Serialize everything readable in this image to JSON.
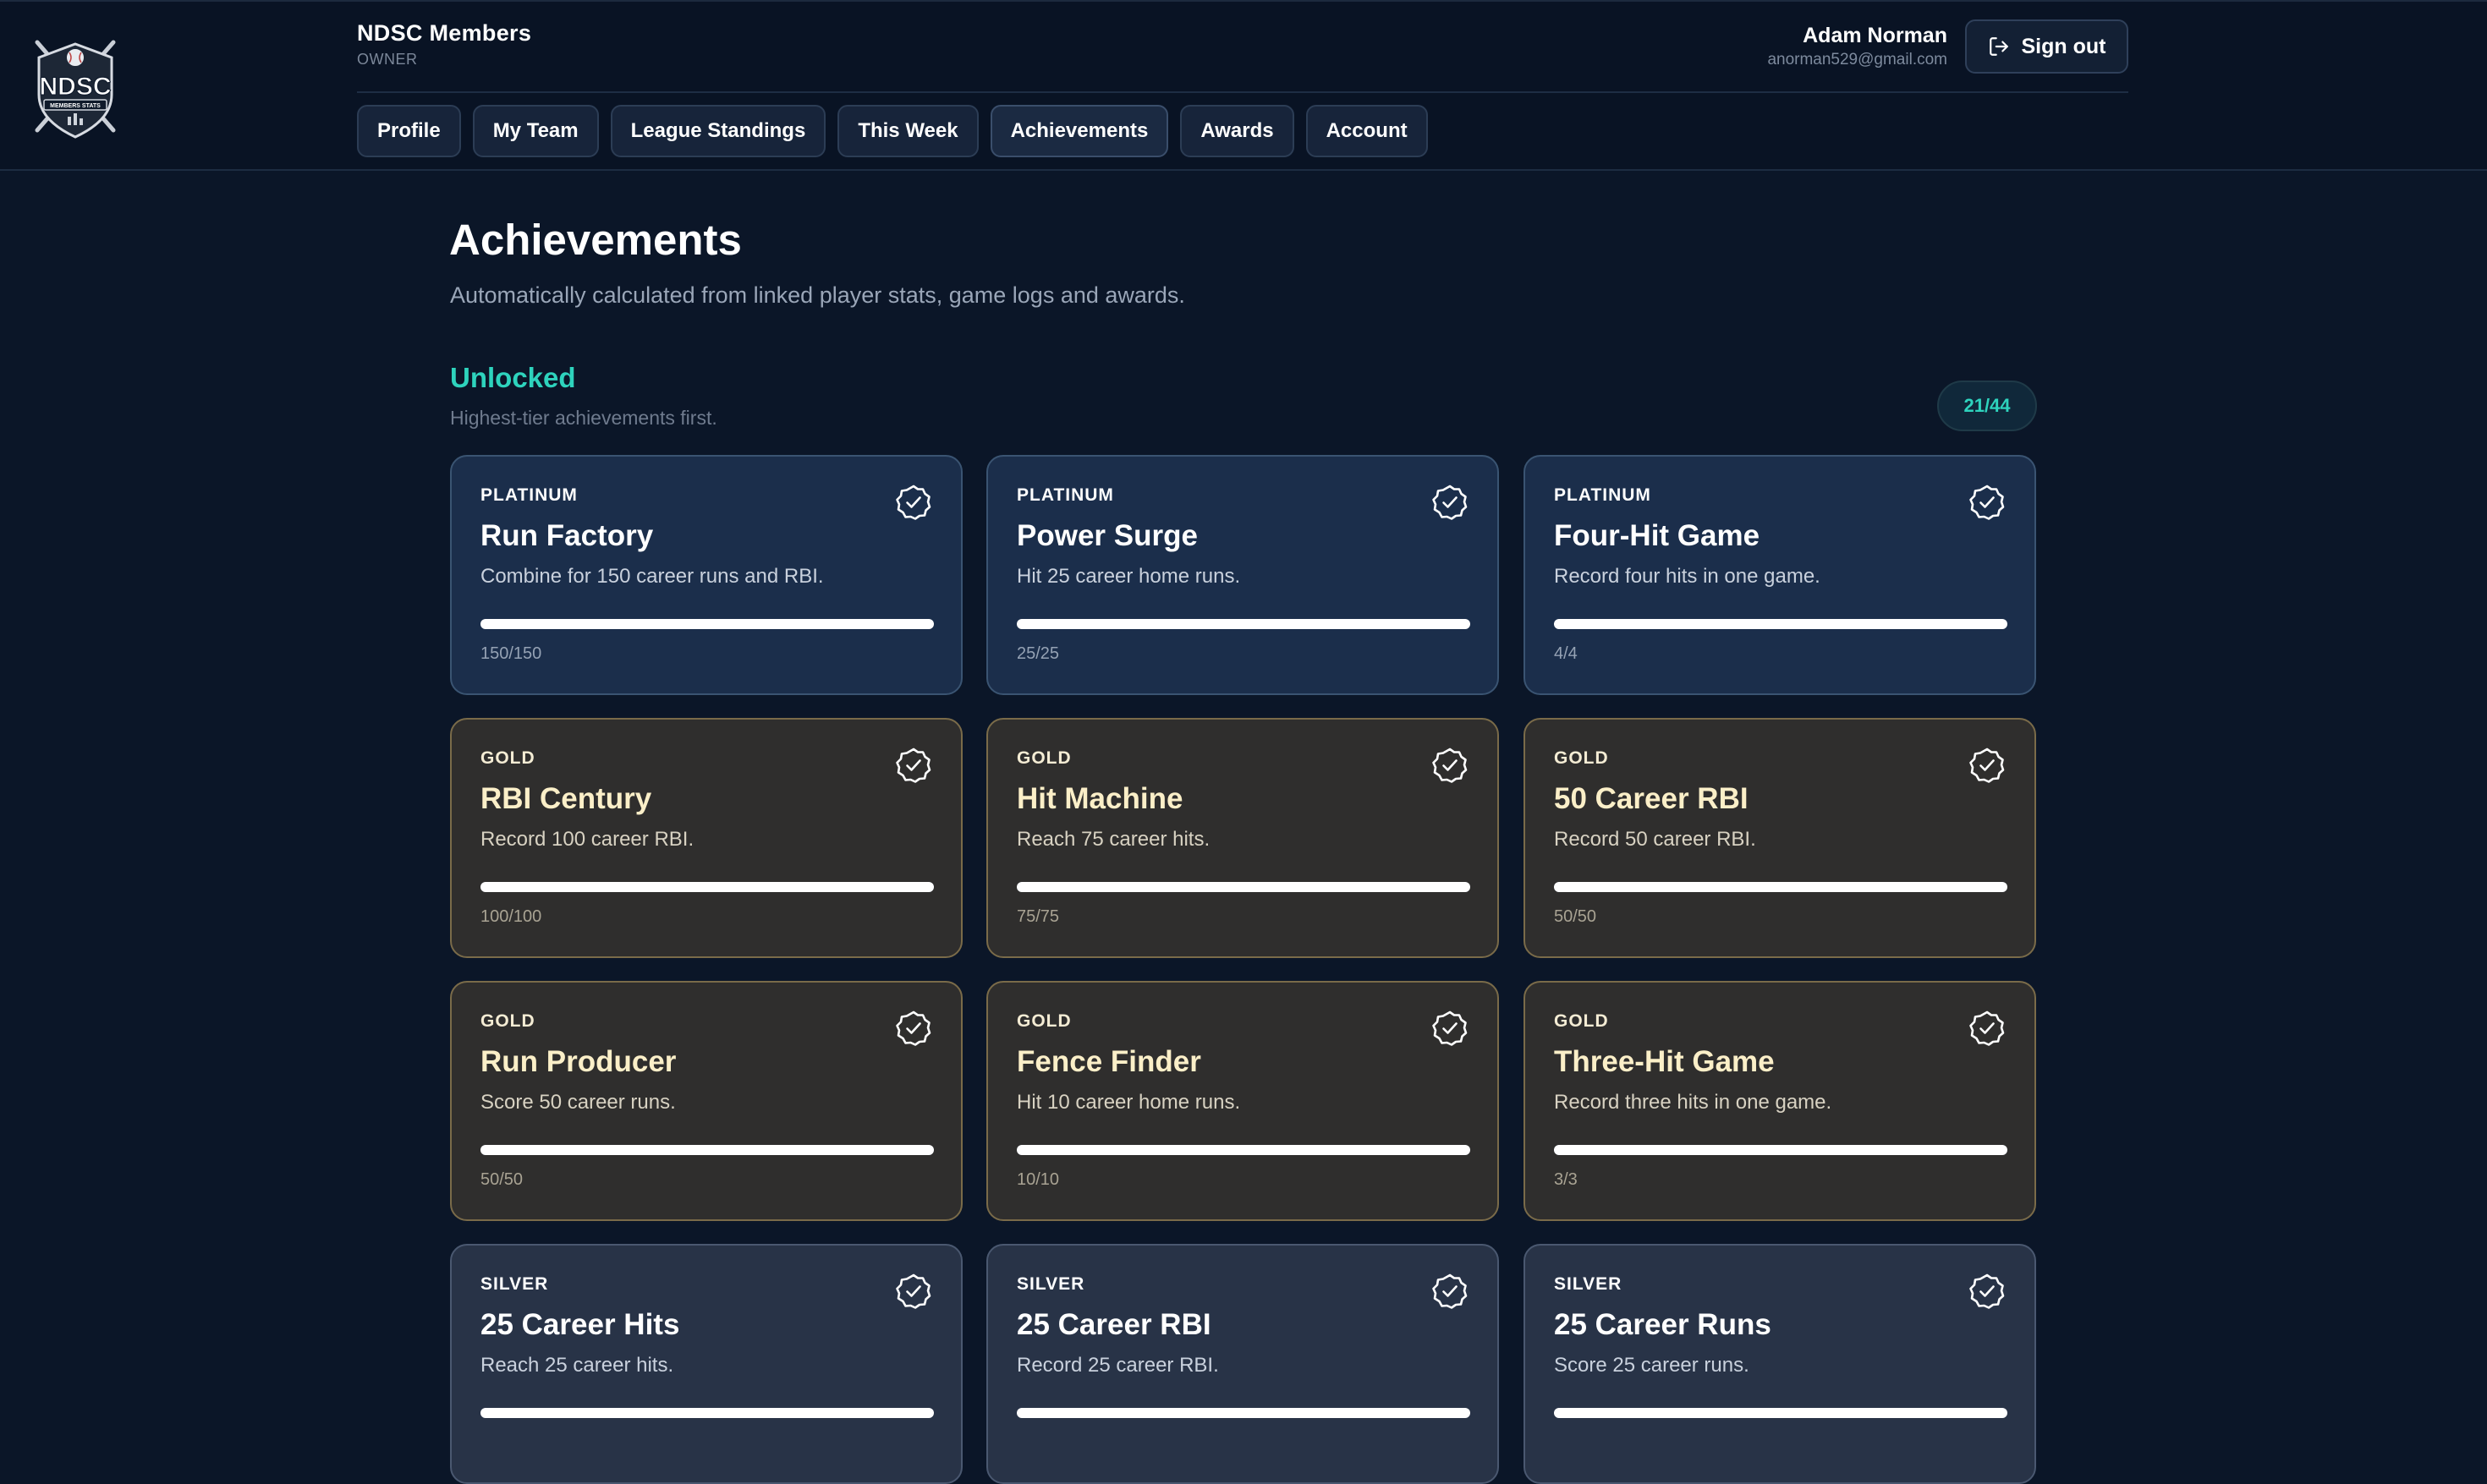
{
  "header": {
    "logo_text": "NDSC",
    "logo_subtext": "MEMBERS STATS",
    "org_name": "NDSC Members",
    "org_role": "OWNER",
    "user_name": "Adam Norman",
    "user_email": "anorman529@gmail.com",
    "signout_label": "Sign out",
    "nav": [
      {
        "label": "Profile"
      },
      {
        "label": "My Team"
      },
      {
        "label": "League Standings"
      },
      {
        "label": "This Week"
      },
      {
        "label": "Achievements"
      },
      {
        "label": "Awards"
      },
      {
        "label": "Account"
      }
    ],
    "active_nav": "Achievements"
  },
  "page": {
    "title": "Achievements",
    "subtitle": "Automatically calculated from linked player stats, game logs and awards."
  },
  "section": {
    "title": "Unlocked",
    "subtitle": "Highest-tier achievements first.",
    "count": "21/44"
  },
  "colors": {
    "accent": "#2ed3bd",
    "platinum_bg": "#1b2e4b",
    "gold_bg": "#2f2e2d",
    "silver_bg": "#283347",
    "background": "#0b1628"
  },
  "achievements": [
    {
      "tier": "PLATINUM",
      "name": "Run Factory",
      "description": "Combine for 150 career runs and RBI.",
      "progress_text": "150/150",
      "progress": 1.0,
      "icon": "check-badge-icon"
    },
    {
      "tier": "PLATINUM",
      "name": "Power Surge",
      "description": "Hit 25 career home runs.",
      "progress_text": "25/25",
      "progress": 1.0,
      "icon": "check-badge-icon"
    },
    {
      "tier": "PLATINUM",
      "name": "Four-Hit Game",
      "description": "Record four hits in one game.",
      "progress_text": "4/4",
      "progress": 1.0,
      "icon": "check-badge-icon"
    },
    {
      "tier": "GOLD",
      "name": "RBI Century",
      "description": "Record 100 career RBI.",
      "progress_text": "100/100",
      "progress": 1.0,
      "icon": "check-badge-icon"
    },
    {
      "tier": "GOLD",
      "name": "Hit Machine",
      "description": "Reach 75 career hits.",
      "progress_text": "75/75",
      "progress": 1.0,
      "icon": "check-badge-icon"
    },
    {
      "tier": "GOLD",
      "name": "50 Career RBI",
      "description": "Record 50 career RBI.",
      "progress_text": "50/50",
      "progress": 1.0,
      "icon": "check-badge-icon"
    },
    {
      "tier": "GOLD",
      "name": "Run Producer",
      "description": "Score 50 career runs.",
      "progress_text": "50/50",
      "progress": 1.0,
      "icon": "check-badge-icon"
    },
    {
      "tier": "GOLD",
      "name": "Fence Finder",
      "description": "Hit 10 career home runs.",
      "progress_text": "10/10",
      "progress": 1.0,
      "icon": "check-badge-icon"
    },
    {
      "tier": "GOLD",
      "name": "Three-Hit Game",
      "description": "Record three hits in one game.",
      "progress_text": "3/3",
      "progress": 1.0,
      "icon": "check-badge-icon"
    },
    {
      "tier": "SILVER",
      "name": "25 Career Hits",
      "description": "Reach 25 career hits.",
      "progress_text": "",
      "progress": 1.0,
      "icon": "check-badge-icon"
    },
    {
      "tier": "SILVER",
      "name": "25 Career RBI",
      "description": "Record 25 career RBI.",
      "progress_text": "",
      "progress": 1.0,
      "icon": "check-badge-icon"
    },
    {
      "tier": "SILVER",
      "name": "25 Career Runs",
      "description": "Score 25 career runs.",
      "progress_text": "",
      "progress": 1.0,
      "icon": "check-badge-icon"
    }
  ]
}
